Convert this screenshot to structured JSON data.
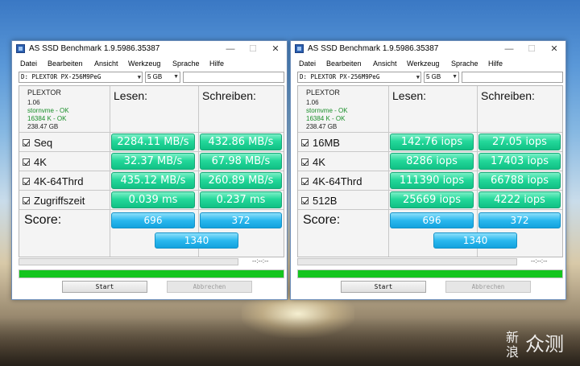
{
  "watermark": {
    "small": "新浪",
    "big": "众测"
  },
  "windows": [
    {
      "title": "AS SSD Benchmark 1.9.5986.35387",
      "controls": {
        "minimize": "—",
        "maximize": "☐",
        "close": "✕"
      },
      "menu": [
        "Datei",
        "Bearbeiten",
        "Ansicht",
        "Werkzeug",
        "Sprache",
        "Hilfe"
      ],
      "drive": "D: PLEXTOR PX-256M9PeG",
      "size": "5 GB",
      "device": {
        "name": "PLEXTOR",
        "firmware": "1.06",
        "driver": "stornvme - OK",
        "alignment": "16384 K - OK",
        "capacity": "238.47 GB"
      },
      "headers": {
        "read": "Lesen:",
        "write": "Schreiben:"
      },
      "rows": [
        {
          "label": "Seq",
          "read": "2284.11 MB/s",
          "write": "432.86 MB/s"
        },
        {
          "label": "4K",
          "read": "32.37 MB/s",
          "write": "67.98 MB/s"
        },
        {
          "label": "4K-64Thrd",
          "read": "435.12 MB/s",
          "write": "260.89 MB/s"
        },
        {
          "label": "Zugriffszeit",
          "read": "0.039 ms",
          "write": "0.237 ms"
        }
      ],
      "score": {
        "label": "Score:",
        "read": "696",
        "write": "372",
        "total": "1340"
      },
      "elapsed": "--:--:--",
      "progress": 1.0,
      "buttons": {
        "start": "Start",
        "abort": "Abbrechen"
      }
    },
    {
      "title": "AS SSD Benchmark 1.9.5986.35387",
      "controls": {
        "minimize": "—",
        "maximize": "☐",
        "close": "✕"
      },
      "menu": [
        "Datei",
        "Bearbeiten",
        "Ansicht",
        "Werkzeug",
        "Sprache",
        "Hilfe"
      ],
      "drive": "D: PLEXTOR PX-256M9PeG",
      "size": "5 GB",
      "device": {
        "name": "PLEXTOR",
        "firmware": "1.06",
        "driver": "stornvme - OK",
        "alignment": "16384 K - OK",
        "capacity": "238.47 GB"
      },
      "headers": {
        "read": "Lesen:",
        "write": "Schreiben:"
      },
      "rows": [
        {
          "label": "16MB",
          "read": "142.76 iops",
          "write": "27.05 iops"
        },
        {
          "label": "4K",
          "read": "8286 iops",
          "write": "17403 iops"
        },
        {
          "label": "4K-64Thrd",
          "read": "111390 iops",
          "write": "66788 iops"
        },
        {
          "label": "512B",
          "read": "25669 iops",
          "write": "4222 iops"
        }
      ],
      "score": {
        "label": "Score:",
        "read": "696",
        "write": "372",
        "total": "1340"
      },
      "elapsed": "--:--:--",
      "progress": 1.0,
      "buttons": {
        "start": "Start",
        "abort": "Abbrechen"
      }
    }
  ]
}
